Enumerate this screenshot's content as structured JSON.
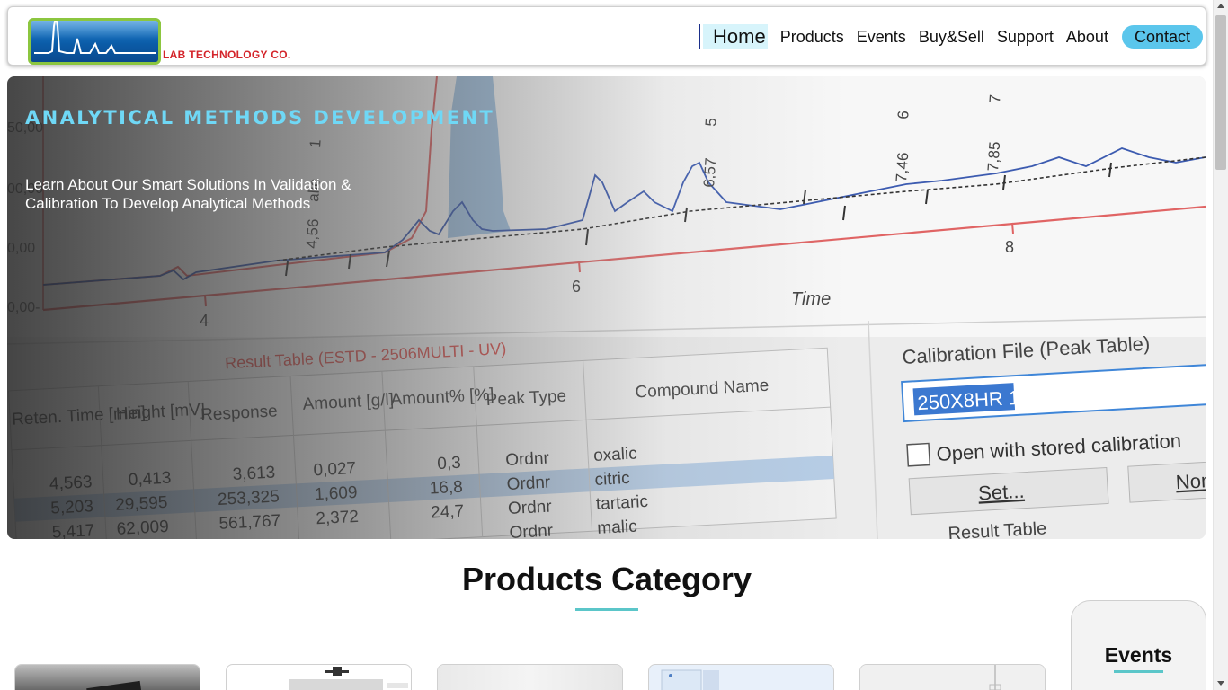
{
  "brand": {
    "name": "LAB TECHNOLOGY CO.",
    "logo_icon": "chromatogram-peak-logo",
    "colors": {
      "logo_text": "#d4242a",
      "logo_border": "#8cc63f",
      "logo_fill": "#0b5ca8"
    }
  },
  "nav": {
    "items": [
      {
        "label": "Home",
        "active": true
      },
      {
        "label": "Products"
      },
      {
        "label": "Events"
      },
      {
        "label": "Buy&Sell"
      },
      {
        "label": "Support"
      },
      {
        "label": "About"
      }
    ],
    "contact_label": "Contact",
    "colors": {
      "active_bg": "#d7f4fb",
      "contact_bg": "#5bc6ec"
    }
  },
  "hero": {
    "title": "ANALYTICAL METHODS DEVELOPMENT",
    "subtitle": "Learn About Our Smart Solutions In Validation & Calibration To Develop Analytical Methods",
    "title_color": "#6fd8f6",
    "image": {
      "axis_label": "Time",
      "x_ticks": [
        "4",
        "6",
        "8"
      ],
      "y_ticks": [
        "50,00",
        "00,00",
        "0,00",
        "0,00-"
      ],
      "peak_labels": [
        "4,56",
        "alic",
        "1",
        "6,57",
        "5",
        "7,46",
        "6",
        "7,85",
        "7"
      ],
      "result_table": {
        "title": "Result Table (ESTD - 2506MULTI - UV)",
        "headers": [
          "Reten. Time [min]",
          "Height [mV]",
          "Response",
          "Amount [g/l]",
          "Amount% [%]",
          "Peak Type",
          "Compound Name"
        ],
        "rows": [
          [
            "4,563",
            "0,413",
            "3,613",
            "0,027",
            "0,3",
            "Ordnr",
            "oxalic"
          ],
          [
            "5,203",
            "29,595",
            "253,325",
            "1,609",
            "16,8",
            "Ordnr",
            "citric"
          ],
          [
            "5,417",
            "62,009",
            "561,767",
            "2,372",
            "24,7",
            "Ordnr",
            "tartaric"
          ],
          [
            "",
            "",
            "",
            "",
            "",
            "Ordnr",
            "malic"
          ]
        ]
      },
      "calibration": {
        "title": "Calibration File (Peak Table)",
        "file_value": "250X8HR 1",
        "checkbox_label": "Open with stored calibration",
        "set_button": "Set...",
        "none_button": "Non",
        "footer": "Result Table"
      }
    }
  },
  "products": {
    "title": "Products Category",
    "cards": [
      {
        "name": "product-card-1"
      },
      {
        "name": "product-card-2"
      },
      {
        "name": "product-card-3"
      },
      {
        "name": "product-card-4"
      },
      {
        "name": "product-card-5"
      }
    ]
  },
  "events_panel": {
    "title": "Events"
  }
}
